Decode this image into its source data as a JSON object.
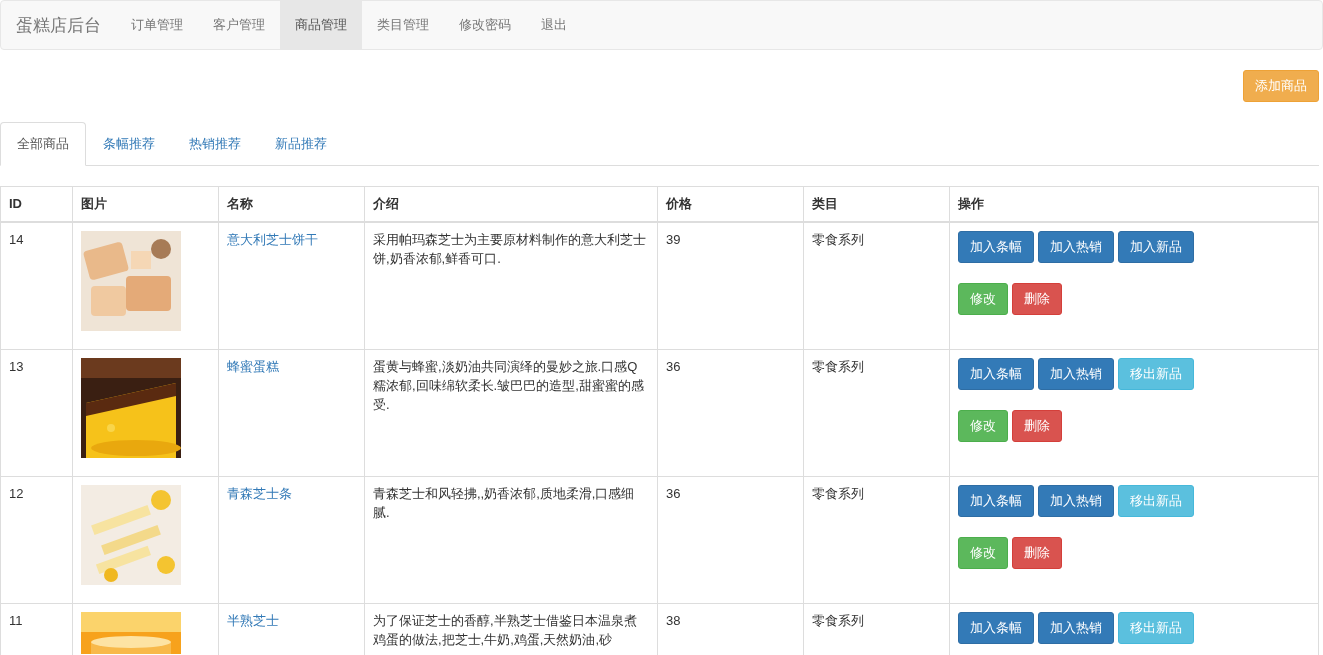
{
  "navbar": {
    "brand": "蛋糕店后台",
    "items": [
      {
        "label": "订单管理",
        "selected": false
      },
      {
        "label": "客户管理",
        "selected": false
      },
      {
        "label": "商品管理",
        "selected": true
      },
      {
        "label": "类目管理",
        "selected": false
      },
      {
        "label": "修改密码",
        "selected": false
      },
      {
        "label": "退出",
        "selected": false
      }
    ]
  },
  "add_button": {
    "label": "添加商品",
    "kind": "warning"
  },
  "tabs": [
    {
      "label": "全部商品",
      "selected": true
    },
    {
      "label": "条幅推荐",
      "selected": false
    },
    {
      "label": "热销推荐",
      "selected": false
    },
    {
      "label": "新品推荐",
      "selected": false
    }
  ],
  "table": {
    "columns": [
      "ID",
      "图片",
      "名称",
      "介绍",
      "价格",
      "类目",
      "操作"
    ],
    "rows": [
      {
        "id": "14",
        "name": "意大利芝士饼干",
        "description": "采用帕玛森芝士为主要原材料制作的意大利芝士饼,奶香浓郁,鲜香可口.",
        "price": "39",
        "category": "零食系列",
        "actions": [
          {
            "label": "加入条幅",
            "kind": "primary"
          },
          {
            "label": "加入热销",
            "kind": "primary"
          },
          {
            "label": "加入新品",
            "kind": "primary"
          },
          {
            "label": "修改",
            "kind": "success"
          },
          {
            "label": "删除",
            "kind": "danger"
          }
        ]
      },
      {
        "id": "13",
        "name": "蜂蜜蛋糕",
        "description": "蛋黄与蜂蜜,淡奶油共同演绎的曼妙之旅.口感Q糯浓郁,回味绵软柔长.皱巴巴的造型,甜蜜蜜的感受.",
        "price": "36",
        "category": "零食系列",
        "actions": [
          {
            "label": "加入条幅",
            "kind": "primary"
          },
          {
            "label": "加入热销",
            "kind": "primary"
          },
          {
            "label": "移出新品",
            "kind": "info"
          },
          {
            "label": "修改",
            "kind": "success"
          },
          {
            "label": "删除",
            "kind": "danger"
          }
        ]
      },
      {
        "id": "12",
        "name": "青森芝士条",
        "description": "青森芝士和风轻拂,,奶香浓郁,质地柔滑,口感细腻.",
        "price": "36",
        "category": "零食系列",
        "actions": [
          {
            "label": "加入条幅",
            "kind": "primary"
          },
          {
            "label": "加入热销",
            "kind": "primary"
          },
          {
            "label": "移出新品",
            "kind": "info"
          },
          {
            "label": "修改",
            "kind": "success"
          },
          {
            "label": "删除",
            "kind": "danger"
          }
        ]
      },
      {
        "id": "11",
        "name": "半熟芝士",
        "description": "为了保证芝士的香醇,半熟芝士借鉴日本温泉煮鸡蛋的做法,把芝士,牛奶,鸡蛋,天然奶油,砂",
        "price": "38",
        "category": "零食系列",
        "actions": [
          {
            "label": "加入条幅",
            "kind": "primary"
          },
          {
            "label": "加入热销",
            "kind": "primary"
          },
          {
            "label": "移出新品",
            "kind": "info"
          }
        ]
      }
    ]
  }
}
